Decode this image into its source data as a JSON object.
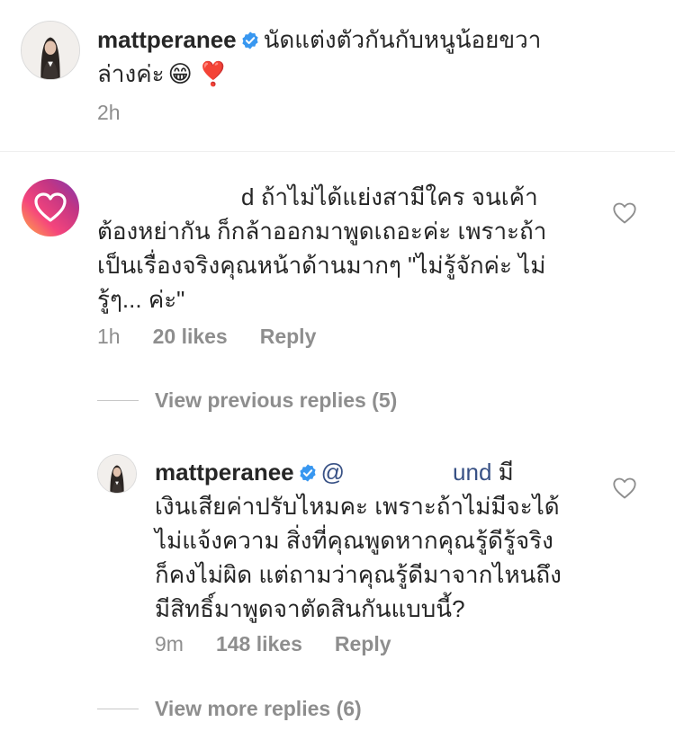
{
  "caption": {
    "username": "mattperanee",
    "text_line1": "นัดแต่งตัวกันกับหนูน้อยขวา",
    "text_line2": "ล่างค่ะ",
    "emoji": "😁 ❣️",
    "time": "2h"
  },
  "comments": [
    {
      "username_fragment": "d",
      "line1": "ถ้าไม่ได้แย่งสามีใคร จนเค้า",
      "line2": "ต้องหย่ากัน ก็กล้าออกมาพูดเถอะค่ะ เพราะถ้า",
      "line3": "เป็นเรื่องจริงคุณหน้าด้านมากๆ \"ไม่รู้จักค่ะ ไม่",
      "line4": "รู้ๆ... ค่ะ\"",
      "time": "1h",
      "likes": "20 likes",
      "reply": "Reply"
    }
  ],
  "view_previous": "View previous replies (5)",
  "reply": {
    "username": "mattperanee",
    "mention_start": "@",
    "mention_end": "und",
    "line1_tail": "มี",
    "line2": "เงินเสียค่าปรับไหมคะ เพราะถ้าไม่มีจะได้",
    "line3": "ไม่แจ้งความ สิ่งที่คุณพูดหากคุณรู้ดีรู้จริง",
    "line4": "ก็คงไม่ผิด แต่ถามว่าคุณรู้ดีมาจากไหนถึง",
    "line5": "มีสิทธิ์มาพูดจาตัดสินกันแบบนี้?",
    "time": "9m",
    "likes": "148 likes",
    "reply_label": "Reply"
  },
  "view_more": "View more replies (6)",
  "colors": {
    "text": "#262626",
    "secondary": "#8e8e8e",
    "verified": "#3897f0",
    "mention": "#385185"
  }
}
